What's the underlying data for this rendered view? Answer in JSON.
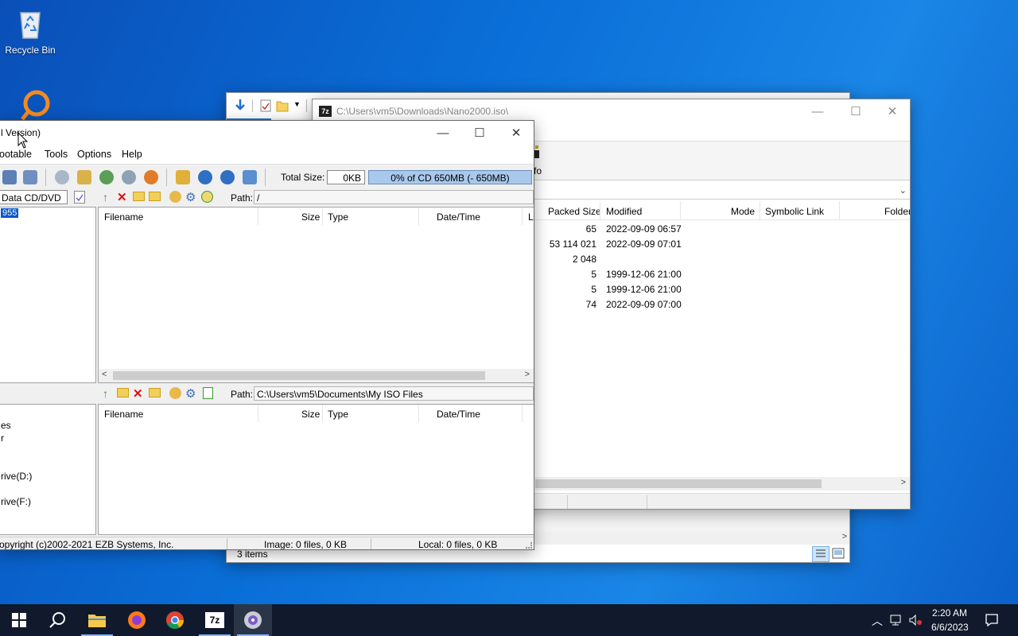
{
  "desktop": {
    "recycle_bin_label": "Recycle Bin"
  },
  "explorer": {
    "status_items": "3 items"
  },
  "sevenzip": {
    "title_path": "C:\\Users\\vm5\\Downloads\\Nano2000.iso\\",
    "app_badge": "7z",
    "info_label": "fo",
    "columns": [
      "Packed Size",
      "Modified",
      "Mode",
      "Symbolic Link",
      "Folder"
    ],
    "rows": [
      {
        "size": "65",
        "modified": "2022-09-09 06:57"
      },
      {
        "size": "53 114 021",
        "modified": "2022-09-09 07:01"
      },
      {
        "size": "2 048",
        "modified": ""
      },
      {
        "size": "5",
        "modified": "1999-12-06 21:00"
      },
      {
        "size": "5",
        "modified": "1999-12-06 21:00"
      },
      {
        "size": "74",
        "modified": "2022-09-09 07:00"
      }
    ]
  },
  "ultra": {
    "title": "l Version)",
    "menu": [
      "ootable",
      "Tools",
      "Options",
      "Help"
    ],
    "total_size_label": "Total Size:",
    "total_size_value": "0KB",
    "capacity_bar": "0% of CD 650MB (- 650MB)",
    "disc_type": "Data CD/DVD",
    "tree_selected": "955",
    "path_label": "Path:",
    "image_path": "/",
    "local_path": "C:\\Users\\vm5\\Documents\\My ISO Files",
    "columns": [
      "Filename",
      "Size",
      "Type",
      "Date/Time",
      "L"
    ],
    "local_columns": [
      "Filename",
      "Size",
      "Type",
      "Date/Time"
    ],
    "local_tree": [
      "es",
      "r",
      "rive(D:)",
      "rive(F:)"
    ],
    "status_copyright": "opyright (c)2002-2021 EZB Systems, Inc.",
    "status_image": "Image: 0 files, 0 KB",
    "status_local": "Local: 0 files, 0 KB"
  },
  "taskbar": {
    "sevenzip_badge": "7z",
    "time": "2:20 AM",
    "date": "6/6/2023"
  },
  "colors": {
    "accent": "#0a6fd8",
    "capacity_fill": "#a8c8ec",
    "taskbar": "#101a2c"
  }
}
